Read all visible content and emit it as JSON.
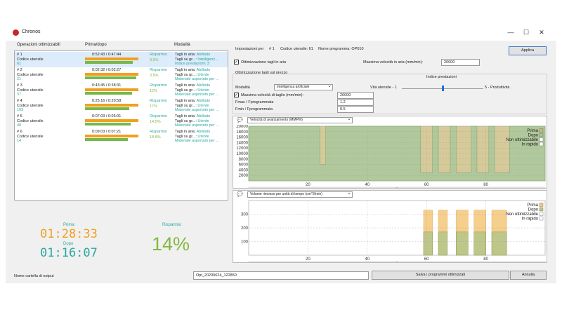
{
  "window": {
    "title": "Chronos",
    "minimize": "—",
    "maximize": "☐",
    "close": "✕"
  },
  "list": {
    "headers": {
      "operations": "Operazioni ottimizzabili",
      "before_after": "Prima/dopo",
      "mode": "Modalità"
    },
    "rows": [
      {
        "num": "# 1",
        "code_label": "Codice utensile",
        "code": "61",
        "times": "0:52:43 / 0:47:44",
        "before_fraction": 0.84,
        "after_fraction": 0.76,
        "saving_label": "Risparmio",
        "saving": "9.5%",
        "m1": "Tagli in aria:",
        "m1v": "Abilitato",
        "m2": "Tagli su gr...:",
        "m2v": "Intelligenz...",
        "m3": "Indice prestazioni: 3"
      },
      {
        "num": "# 2",
        "code_label": "Codice utensile",
        "code": "21",
        "times": "0:02:32 / 0:02:27",
        "before_fraction": 0.84,
        "after_fraction": 0.81,
        "saving_label": "Risparmio",
        "saving": "3.5%",
        "m1": "Tagli in aria:",
        "m1v": "Abilitato",
        "m2": "Tagli su gr...:",
        "m2v": "Utente",
        "m3": "Materiale asportato per ..."
      },
      {
        "num": "# 3",
        "code_label": "Codice utensile",
        "code": "37",
        "times": "0:43:45 / 0:38:31",
        "before_fraction": 0.84,
        "after_fraction": 0.74,
        "saving_label": "Risparmio",
        "saving": "12%",
        "m1": "Tagli in aria:",
        "m1v": "Abilitato",
        "m2": "Tagli su gr...:",
        "m2v": "Utente",
        "m3": "Materiale asportato per ..."
      },
      {
        "num": "# 4",
        "code_label": "Codice utensile",
        "code": "103",
        "times": "0:25:16 / 0:20:58",
        "before_fraction": 0.84,
        "after_fraction": 0.7,
        "saving_label": "Risparmio",
        "saving": "17%",
        "m1": "Tagli in aria:",
        "m1v": "Abilitato",
        "m2": "Tagli su gr...:",
        "m2v": "Utente",
        "m3": "Materiale asportato per ..."
      },
      {
        "num": "# 5",
        "code_label": "Codice utensile",
        "code": "40",
        "times": "0:07:03 / 0:06:01",
        "before_fraction": 0.84,
        "after_fraction": 0.72,
        "saving_label": "Risparmio",
        "saving": "14.5%",
        "m1": "Tagli in aria:",
        "m1v": "Abilitato",
        "m2": "Tagli su gr...:",
        "m2v": "Utente",
        "m3": "Materiale asportato per ..."
      },
      {
        "num": "# 6",
        "code_label": "Codice utensile",
        "code": "14",
        "times": "0:09:03 / 0:07:21",
        "before_fraction": 0.84,
        "after_fraction": 0.68,
        "saving_label": "Risparmio",
        "saving": "18.8%",
        "m1": "Tagli in aria:",
        "m1v": "Abilitato",
        "m2": "Tagli su gr...:",
        "m2v": "Utente",
        "m3": "Materiale asportato per ..."
      }
    ]
  },
  "summary": {
    "before_label": "Prima",
    "before": "01:28:33",
    "after_label": "Dopo",
    "after": "01:16:07",
    "saving_label": "Risparmio",
    "saving": "14%"
  },
  "settings": {
    "header": {
      "prefix": "Impostazioni per",
      "num": "# 1",
      "tool": "Codice utensile: 61",
      "program": "Nome programma: OP010"
    },
    "apply": "Applica",
    "air_opt_label": "Ottimizzazione tagli in aria",
    "air_opt_checked": true,
    "air_speed_label": "Massima velocità in aria (mm/min):",
    "air_speed": "20000",
    "solid_group": "Ottimizzazione tagli sul grezzo",
    "perf_label": "Indice prestazioni",
    "mode_label": "Modalità",
    "mode_value": "Intelligenza artificiale",
    "tool_life": "Vita utensile - 1",
    "productivity": "5 - Produttività",
    "slider_level": 3,
    "max_cut_label": "Massima velocità di taglio (mm/min):",
    "max_cut_checked": true,
    "max_cut": "20000",
    "fmax_label": "Fmax / Fprogrammata",
    "fmax": "1.2",
    "fmin_label": "Fmin / Fprogrammata",
    "fmin": "0.5"
  },
  "chart_data": [
    {
      "type": "area",
      "selector": "Velocità di avanzamento (MMPM)",
      "yticks": [
        "20000",
        "18000",
        "16000",
        "14000",
        "12000",
        "10000",
        "8000",
        "6000",
        "4000",
        "2000"
      ],
      "xticks": [
        "20",
        "40",
        "60",
        "80"
      ],
      "ylim": [
        0,
        20000
      ],
      "xlim": [
        0,
        100
      ],
      "legend": [
        "Prima",
        "Dopo",
        "Non ottimizzabile",
        "In rapido"
      ],
      "legend_position": "top-right",
      "colors": {
        "prima": "#c8b878",
        "dopo": "#9cc89c",
        "non_ott": "#ffffff",
        "rapido": "#ffffff"
      },
      "series": [
        {
          "name": "Prima",
          "points": [
            [
              0,
              20000
            ],
            [
              100,
              20000
            ]
          ]
        },
        {
          "name": "Dopo",
          "points": [
            [
              0,
              20000
            ],
            [
              24,
              20000
            ],
            [
              24,
              6000
            ],
            [
              26,
              6000
            ],
            [
              26,
              20000
            ],
            [
              58,
              20000
            ],
            [
              58,
              3000
            ],
            [
              62,
              3000
            ],
            [
              62,
              20000
            ],
            [
              64,
              20000
            ],
            [
              64,
              3000
            ],
            [
              68,
              3000
            ],
            [
              68,
              20000
            ],
            [
              70,
              20000
            ],
            [
              70,
              3000
            ],
            [
              75,
              3000
            ],
            [
              75,
              20000
            ],
            [
              77,
              20000
            ],
            [
              77,
              3000
            ],
            [
              81,
              3000
            ],
            [
              81,
              20000
            ],
            [
              83,
              20000
            ],
            [
              83,
              3000
            ],
            [
              88,
              3000
            ],
            [
              88,
              20000
            ],
            [
              100,
              20000
            ]
          ]
        }
      ]
    },
    {
      "type": "area",
      "selector": "Volume rimosso per unità di tempo (cm^3/min)",
      "yticks": [
        "300",
        "200",
        "100"
      ],
      "xticks": [
        "20",
        "40",
        "60",
        "80"
      ],
      "ylim": [
        0,
        400
      ],
      "xlim": [
        0,
        100
      ],
      "legend": [
        "Prima",
        "Dopo",
        "Non ottimizzabile",
        "In rapido"
      ],
      "legend_position": "top-right",
      "series": [
        {
          "name": "Prima",
          "segments": [
            [
              59,
              62,
              330
            ],
            [
              64,
              67,
              330
            ],
            [
              70,
              74,
              330
            ],
            [
              76,
              80,
              330
            ],
            [
              82,
              87,
              330
            ]
          ]
        },
        {
          "name": "Dopo",
          "segments": [
            [
              59,
              62,
              170
            ],
            [
              64,
              67,
              170
            ],
            [
              70,
              74,
              170
            ],
            [
              76,
              80,
              170
            ],
            [
              82,
              87,
              170
            ]
          ]
        }
      ]
    }
  ],
  "footer": {
    "output_label": "Nome cartella di output",
    "output_value": "Opt_20200624_122850",
    "save": "Salva i programmi ottimizzati",
    "cancel": "Annulla"
  }
}
